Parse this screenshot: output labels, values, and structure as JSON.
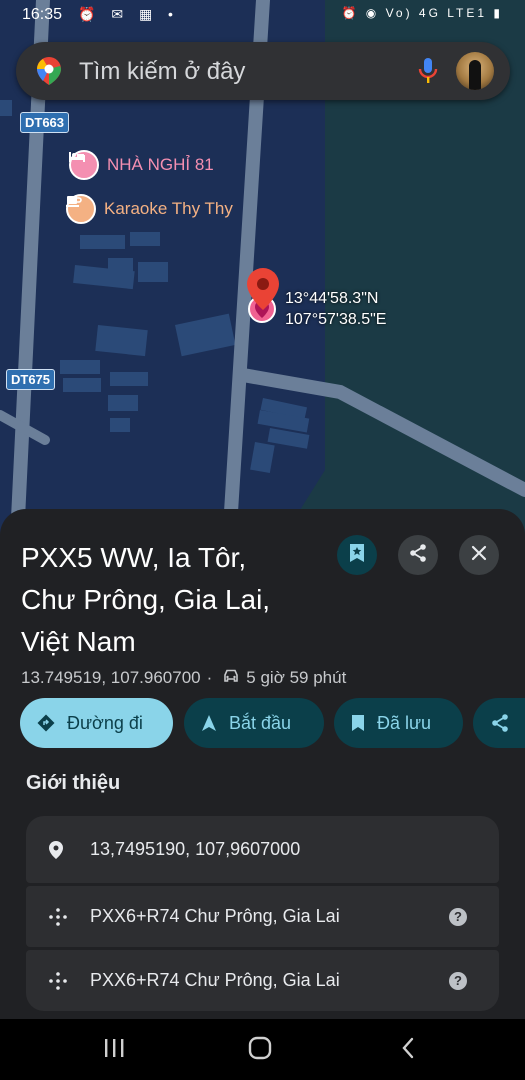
{
  "status_bar": {
    "time": "16:35",
    "left_icons": [
      "alarm-icon",
      "messenger-icon",
      "capcut-icon",
      "gallery-icon",
      "dot-icon"
    ],
    "right_icons": [
      "alarm-icon",
      "location-icon",
      "volte-icon",
      "4g-icon",
      "signal-icon",
      "battery-icon"
    ],
    "network_text": "Vo) 4G LTE1"
  },
  "search": {
    "placeholder": "Tìm kiếm ở đây"
  },
  "map": {
    "road_labels": [
      "DT663",
      "DT675"
    ],
    "pois": [
      {
        "label": "NHÀ NGHỈ 81",
        "icon": "bed-icon",
        "color": "#f48fb1"
      },
      {
        "label": "Karaoke Thy Thy",
        "icon": "cup-icon",
        "color": "#f4b183"
      }
    ],
    "dropped_pin": {
      "lat": "13°44'58.3\"N",
      "lng": "107°57'38.5\"E",
      "color": "#ea4335"
    }
  },
  "place": {
    "title_lines": [
      "PXX5 WW, Ia Tôr,",
      "Chư Prông, Gia Lai,",
      "Việt Nam"
    ],
    "coords": "13.749519, 107.960700",
    "separator": "·",
    "drive_time": "5 giờ 59 phút"
  },
  "actions": [
    {
      "label": "Đường đi",
      "icon": "directions-icon",
      "primary": true
    },
    {
      "label": "Bắt đầu",
      "icon": "navigation-icon",
      "primary": false
    },
    {
      "label": "Đã lưu",
      "icon": "bookmark-icon",
      "primary": false
    },
    {
      "label": "",
      "icon": "share-icon",
      "primary": false
    }
  ],
  "about": {
    "heading": "Giới thiệu",
    "rows": [
      {
        "icon": "location-pin-icon",
        "text": "13,7495190, 107,9607000",
        "help": false
      },
      {
        "icon": "plus-code-icon",
        "text": "PXX6+R74 Chư Prông, Gia Lai",
        "help": true
      },
      {
        "icon": "plus-code-icon",
        "text": "PXX6+R74 Chư Prông, Gia Lai",
        "help": true
      }
    ]
  },
  "colors": {
    "accent_light": "#8ad4e9",
    "accent_dark": "#0b3f4a",
    "sheet_bg": "#202124",
    "card_bg": "#2d2e31",
    "map_bg": "#1b3a45"
  }
}
